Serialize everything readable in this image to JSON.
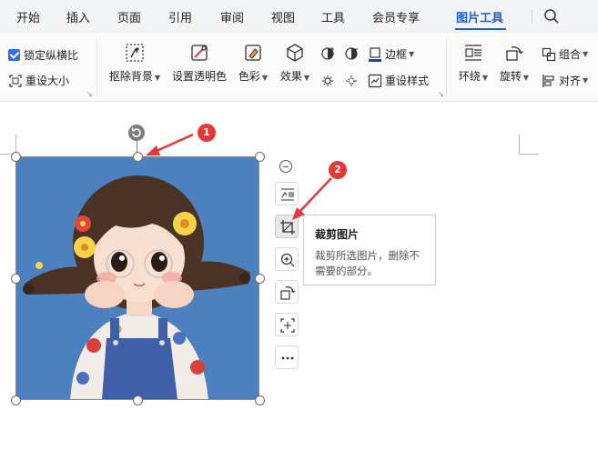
{
  "menu": {
    "tabs": [
      "开始",
      "插入",
      "页面",
      "引用",
      "审阅",
      "视图",
      "工具",
      "会员专享",
      "图片工具"
    ],
    "active_tab": "图片工具"
  },
  "ribbon": {
    "lock_ratio": "锁定纵横比",
    "reset_size": "重设大小",
    "remove_bg": "抠除背景",
    "set_transparent": "设置透明色",
    "color": "色彩",
    "effects": "效果",
    "border": "边框",
    "reset_style": "重设样式",
    "wrap": "环绕",
    "rotate": "旋转",
    "group": "组合",
    "align": "对齐"
  },
  "tooltip": {
    "title": "裁剪图片",
    "description": "裁剪所选图片，删除不需要的部分。"
  },
  "annotations": [
    "1",
    "2"
  ],
  "colors": {
    "accent": "#1f5fd1",
    "picture_bg": "#4d80bf",
    "badge": "#e53935"
  },
  "icons": [
    "search-icon",
    "remove-background-icon",
    "set-transparent-icon",
    "color-icon",
    "effects-icon",
    "brightness-icon",
    "contrast-icon",
    "border-icon",
    "reset-style-icon",
    "wrap-icon",
    "rotate-icon",
    "group-icon",
    "align-icon",
    "crop-icon",
    "zoom-icon",
    "rotate-picture-icon",
    "adjust-icon",
    "more-icon"
  ]
}
